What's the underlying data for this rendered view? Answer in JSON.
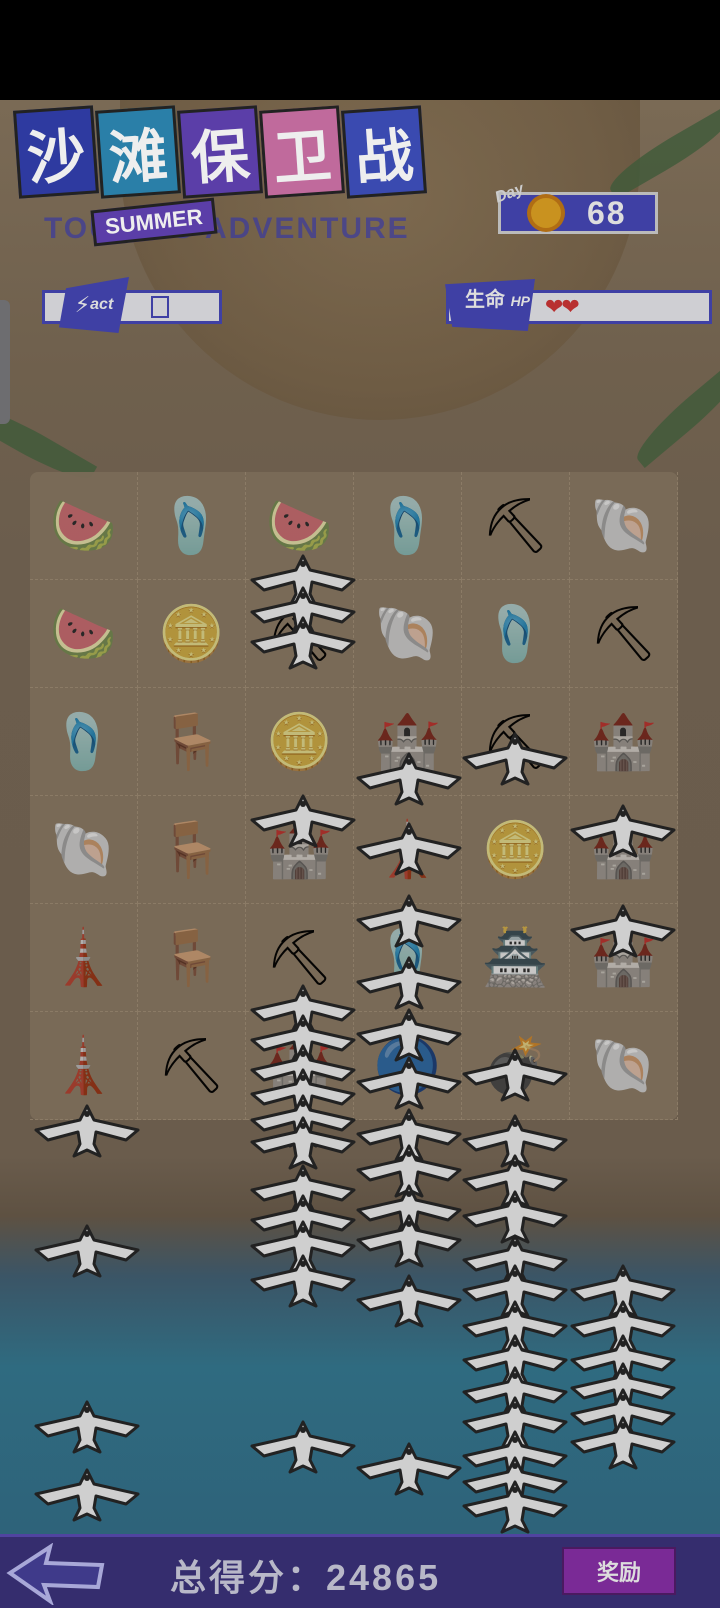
{
  "header": {
    "title_chars": [
      "沙",
      "滩",
      "保",
      "卫",
      "战"
    ],
    "title_colors": [
      "#2e3aa0",
      "#2a7fa8",
      "#5b3ea8",
      "#c06a9c",
      "#3a4ab0"
    ],
    "summer_tag": "SUMMER",
    "subtitle": "TOURING ADVENTURE"
  },
  "day": {
    "label": "Day",
    "value": "68",
    "icon": "sun-icon"
  },
  "act": {
    "label": "act",
    "value": "",
    "icon": "lightning-icon"
  },
  "hp": {
    "label_cn": "生命",
    "label_en": "HP",
    "hearts": "❤❤",
    "lives": 2,
    "icon": "heart-icon"
  },
  "board": {
    "rows": 6,
    "cols": 6,
    "tiles": [
      [
        "watermelon",
        "sandal",
        "watermelon",
        "sandal",
        "sand-shovel",
        "seashell"
      ],
      [
        "watermelon",
        "coins",
        "sand-shovel",
        "seashell",
        "sandal",
        "sand-shovel"
      ],
      [
        "sandal",
        "beach-chair",
        "coins",
        "castle-blue",
        "sand-shovel",
        "castle-blue"
      ],
      [
        "seashell",
        "beach-chair-red",
        "castle-blue",
        "tower-blue",
        "coins",
        "castle-blue"
      ],
      [
        "tower-red",
        "beach-chair",
        "sand-shovel",
        "sandal",
        "castle-red",
        "castle-blue"
      ],
      [
        "tower-blue",
        "sand-shovel",
        "castle-blue",
        "ball",
        "cannon",
        "seashell"
      ]
    ],
    "glyphs": {
      "watermelon": "🍉",
      "sandal": "🩴",
      "sand-shovel": "⛏",
      "seashell": "🐚",
      "coins": "🪙",
      "beach-chair": "🪑",
      "beach-chair-red": "🪑",
      "castle-blue": "🏰",
      "castle-red": "🏯",
      "tower-blue": "🗼",
      "tower-red": "🗼",
      "ball": "🔵",
      "cannon": "💣"
    }
  },
  "seagulls": {
    "count": 62,
    "icon": "seagull-icon"
  },
  "footer": {
    "score_label": "总得分：",
    "score_value": "24865",
    "reward_label": "奖励",
    "back_icon": "back-arrow-icon"
  }
}
